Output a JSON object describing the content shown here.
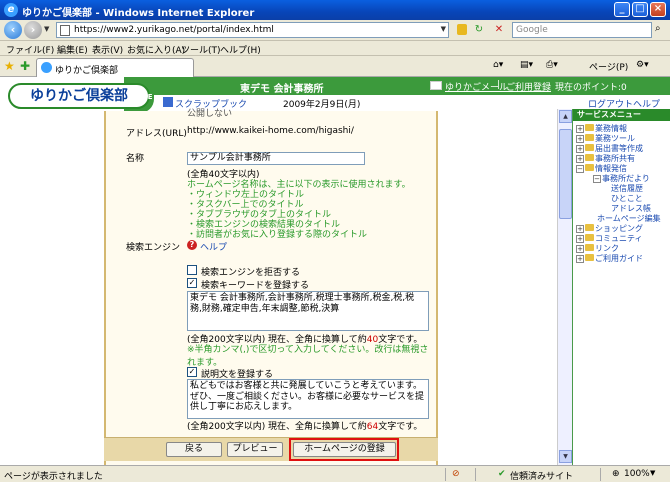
{
  "window": {
    "title": "ゆりかご倶楽部 - Windows Internet Explorer",
    "minimize": "_",
    "maximize": "□",
    "close": "×"
  },
  "addressbar": {
    "url": "https://www2.yurikago.net/portal/index.html",
    "search_placeholder": "Google"
  },
  "menubar": {
    "items": [
      "ファイル(F)",
      "編集(E)",
      "表示(V)",
      "お気に入り(A)",
      "ツール(T)",
      "ヘルプ(H)"
    ]
  },
  "tabbar": {
    "tab_label": "ゆりかご倶楽部",
    "page_menu": "ページ(P)"
  },
  "header": {
    "logo": "ゆりかご倶楽部",
    "home": "HOME",
    "site_title": "東デモ 会計事務所",
    "mail_link": "ゆりかごメール",
    "usage_link": "ご利用登録",
    "points": "現在のポイント:0",
    "scrapbook": "スクラップブック",
    "date": "2009年2月9日(月)",
    "logout": "ログアウト",
    "help": "ヘルプ"
  },
  "form": {
    "cut_top_text": "公開しない",
    "address_label": "アドレス(URL)",
    "address_value": "http://www.kaikei-home.com/higashi/",
    "name_label": "名称",
    "name_value": "サンプル会計事務所",
    "name_limit": "(全角40文字以内)",
    "name_notes": [
      "ホームページ名称は、主に以下の表示に使用されます。",
      "・ウィンドウ左上のタイトル",
      "・タスクバー上でのタイトル",
      "・タブブラウザのタブ上のタイトル",
      "・検索エンジンの検索結果のタイトル",
      "・訪問者がお気に入り登録する際のタイトル"
    ],
    "search_engine_label": "検索エンジン",
    "help_label": "ヘルプ",
    "refuse_search_label": "検索エンジンを拒否する",
    "register_keywords_label": "検索キーワードを登録する",
    "keywords_value": "東デモ 会計事務所,会計事務所,税理士事務所,税金,税,税務,財務,確定申告,年末調整,節税,決算",
    "keywords_count_prefix": "(全角200文字以内) 現在、全角に換算して約",
    "keywords_count": "40",
    "keywords_count_suffix": "文字です。",
    "keywords_note": "※半角カンマ(,)で区切って入力してください。改行は無視されます。",
    "register_desc_label": "説明文を登録する",
    "desc_value": "私どもではお客様と共に発展していこうと考えています。ぜひ、一度ご相談ください。お客様に必要なサービスを提供し丁寧にお応えします。",
    "desc_count_prefix": "(全角200文字以内) 現在、全角に換算して約",
    "desc_count": "64",
    "desc_count_suffix": "文字です。",
    "back_button": "戻る",
    "preview_button": "プレビュー",
    "register_button": "ホームページの登録"
  },
  "sidebar": {
    "header": "サービスメニュー",
    "items": [
      "業務情報",
      "業務ツール",
      "届出書等作成",
      "事務所共有",
      "情報発信",
      "事務所だより",
      "送信履歴",
      "ひとこと",
      "アドレス帳",
      "ホームページ編集",
      "ショッピング",
      "コミュニティ",
      "リンク",
      "ご利用ガイド"
    ]
  },
  "statusbar": {
    "text": "ページが表示されました",
    "zone": "信頼済みサイト",
    "zoom": "100%"
  },
  "colors": {
    "brand_green": "#3c9a3c",
    "note_green": "#2a9a2a",
    "highlight_red": "#e01010",
    "link_blue": "#1a4ab0"
  }
}
